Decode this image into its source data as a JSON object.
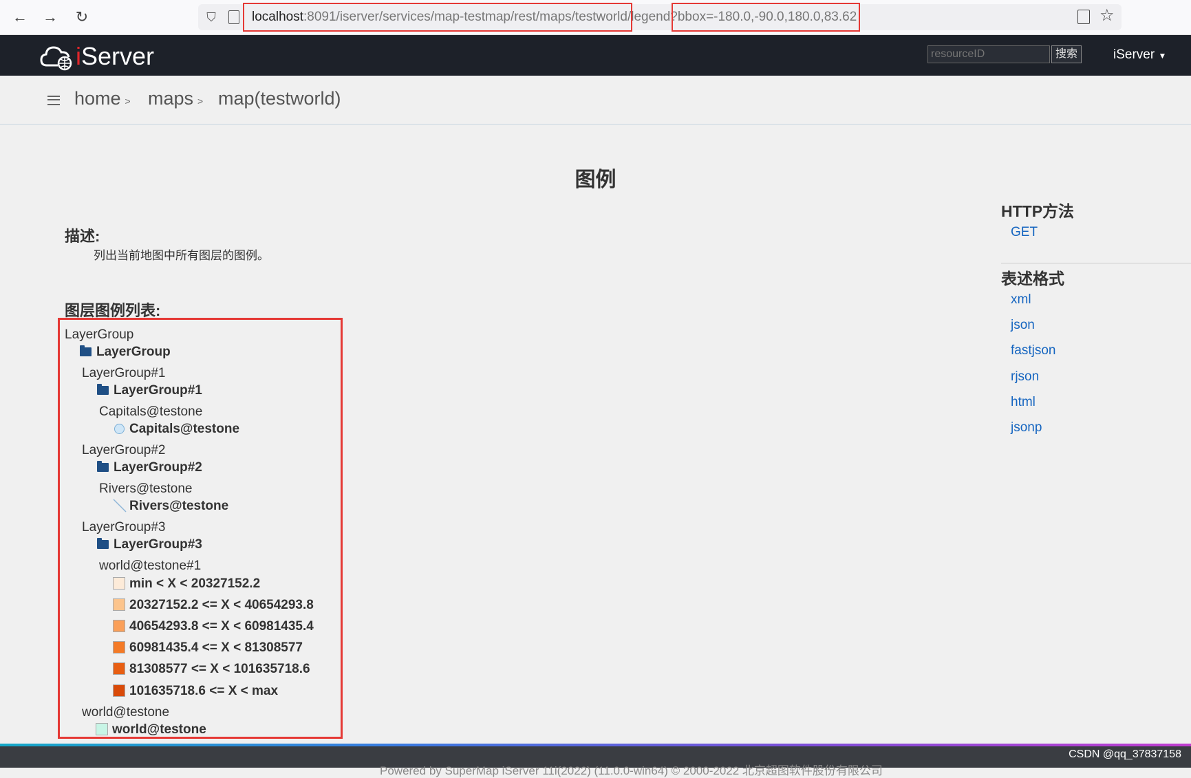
{
  "browser": {
    "url_host": "localhost",
    "url_path": ":8091/iserver/services/map-testmap/rest/maps/testworld",
    "url_tail": "/legend",
    "url_query": "?bbox=-180.0,-90.0,180.0,83.62"
  },
  "header": {
    "logo_text_i": "i",
    "logo_text_rest": "Server",
    "search_placeholder": "resourceID",
    "search_button": "搜索",
    "user_menu": "iServer"
  },
  "breadcrumb": {
    "items": [
      "home",
      "maps",
      "map(testworld)"
    ],
    "separator": ">"
  },
  "page": {
    "title": "图例",
    "description_heading": "描述:",
    "description": "列出当前地图中所有图层的图例。",
    "legend_heading": "图层图例列表:"
  },
  "legend": {
    "root_label": "LayerGroup",
    "root_name": "LayerGroup",
    "group1_label": "LayerGroup#1",
    "group1_name": "LayerGroup#1",
    "capitals_label": "Capitals@testone",
    "capitals_name": "Capitals@testone",
    "group2_label": "LayerGroup#2",
    "group2_name": "LayerGroup#2",
    "rivers_label": "Rivers@testone",
    "rivers_name": "Rivers@testone",
    "group3_label": "LayerGroup#3",
    "group3_name": "LayerGroup#3",
    "world1_label": "world@testone#1",
    "ranges": [
      {
        "label": "min < X < 20327152.2",
        "color": "#fdebd9"
      },
      {
        "label": "20327152.2 <= X < 40654293.8",
        "color": "#fcc48c"
      },
      {
        "label": "40654293.8 <= X < 60981435.4",
        "color": "#fa9f58"
      },
      {
        "label": "60981435.4 <= X < 81308577",
        "color": "#f47a26"
      },
      {
        "label": "81308577 <= X < 101635718.6",
        "color": "#e85e12"
      },
      {
        "label": "101635718.6 <= X < max",
        "color": "#d94a08"
      }
    ],
    "world_label": "world@testone",
    "world_name": "world@testone",
    "world_color": "#c8f5e6"
  },
  "sidebar": {
    "http_heading": "HTTP方法",
    "http_methods": [
      "GET"
    ],
    "format_heading": "表述格式",
    "formats": [
      "xml",
      "json",
      "fastjson",
      "rjson",
      "html",
      "jsonp"
    ]
  },
  "footer": {
    "text": "Powered by SuperMap iServer 11i(2022) (11.0.0-win64) © 2000-2022 北京超图软件股份有限公司",
    "watermark": "CSDN @qq_37837158"
  }
}
